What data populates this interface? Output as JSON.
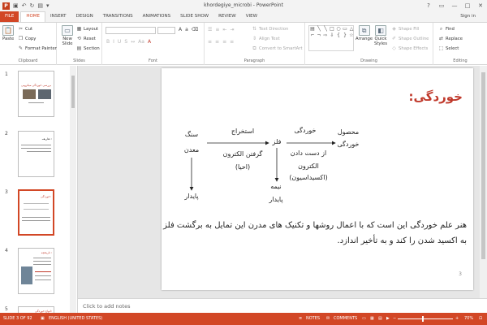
{
  "window": {
    "title": "khordegiye_microbi - PowerPoint",
    "app_letter": "P",
    "quick_access": [
      "save-icon",
      "undo-icon",
      "redo-icon",
      "present-icon"
    ],
    "controls": [
      "?",
      "▭",
      "—",
      "□",
      "✕"
    ]
  },
  "tabs": [
    {
      "label": "FILE",
      "kind": "file"
    },
    {
      "label": "HOME",
      "kind": "active"
    },
    {
      "label": "INSERT"
    },
    {
      "label": "DESIGN"
    },
    {
      "label": "TRANSITIONS"
    },
    {
      "label": "ANIMATIONS"
    },
    {
      "label": "SLIDE SHOW"
    },
    {
      "label": "REVIEW"
    },
    {
      "label": "VIEW"
    }
  ],
  "sign_in": "Sign in",
  "ribbon": {
    "clipboard": {
      "label": "Clipboard",
      "paste": "Paste",
      "cut": "Cut",
      "copy": "Copy",
      "format_painter": "Format Painter"
    },
    "slides": {
      "label": "Slides",
      "new_slide": "New Slide",
      "layout": "Layout",
      "reset": "Reset",
      "section": "Section"
    },
    "font": {
      "label": "Font"
    },
    "paragraph": {
      "label": "Paragraph",
      "text_direction": "Text Direction",
      "align_text": "Align Text",
      "convert": "Convert to SmartArt"
    },
    "drawing": {
      "label": "Drawing",
      "arrange": "Arrange",
      "quick_styles": "Quick Styles",
      "shape_fill": "Shape Fill",
      "shape_outline": "Shape Outline",
      "shape_effects": "Shape Effects"
    },
    "editing": {
      "label": "Editing",
      "find": "Find",
      "replace": "Replace",
      "select": "Select"
    }
  },
  "thumbnails": [
    {
      "num": "1",
      "title": "بررسی خوردگی میکروبی"
    },
    {
      "num": "2",
      "title": "تعاریف :"
    },
    {
      "num": "3",
      "title": "خوردگی:"
    },
    {
      "num": "4",
      "title": "تاریخچه :"
    },
    {
      "num": "5",
      "title": "انواع خوردگی:"
    }
  ],
  "slide": {
    "title": "خوردگی:",
    "diagram": {
      "n1_top": "سنگ",
      "n1_bottom": "معدن",
      "arrow1_top": "استخراج",
      "arrow1_bottom_1": "گرفتن الکترون",
      "arrow1_bottom_2": "(احیا)",
      "n2": "فلز",
      "arrow2_top": "خوردگی",
      "arrow2_bottom_1": "از دست دادن",
      "arrow2_bottom_2": "الکترون",
      "arrow2_bottom_3": "(اکسیداسیون)",
      "n3_1": "محصول",
      "n3_2": "خوردگی",
      "down1": "پایدار",
      "down2_1": "نیمه",
      "down2_2": "پایدار"
    },
    "paragraph": "هنر علم خوردگی این است که با اعمال روشها و تکنیک های مدرن این تمایل به برگشت فلز به اکسید شدن را کند و به تأخیر اندازد.",
    "page_number": "3"
  },
  "notes_placeholder": "Click to add notes",
  "status": {
    "slide_info": "SLIDE 3 OF 92",
    "language": "ENGLISH (UNITED STATES)",
    "notes": "NOTES",
    "comments": "COMMENTS",
    "zoom": "70%"
  },
  "colors": {
    "accent": "#d24726",
    "title_red": "#c0392b"
  }
}
